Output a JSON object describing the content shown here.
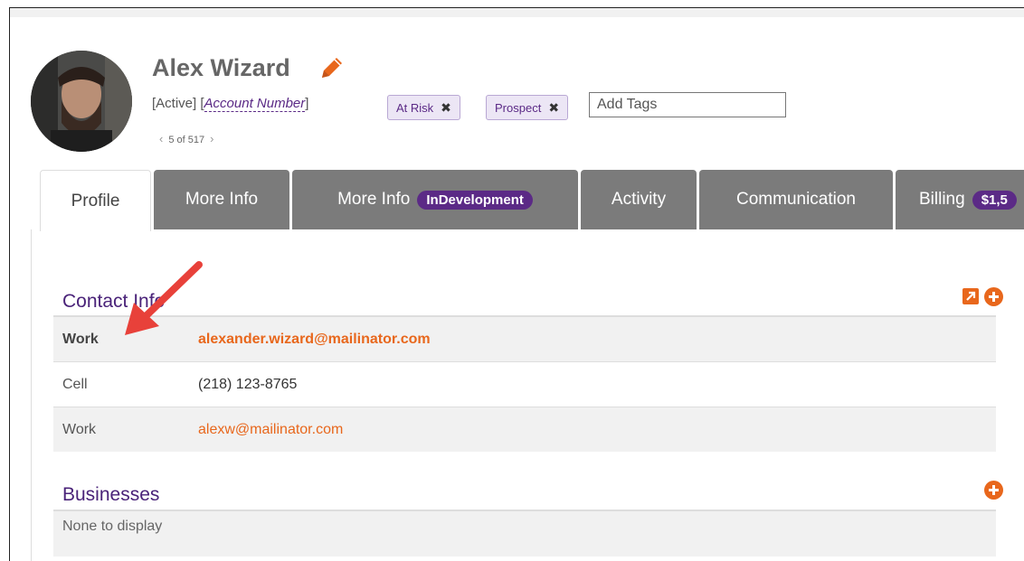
{
  "contact": {
    "name": "Alex Wizard",
    "status": "[Active]",
    "account_open": "[",
    "account_label": "Account Number",
    "account_close": "]",
    "tags": [
      "At Risk",
      "Prospect"
    ],
    "tag_remove_glyph": "✖",
    "tag_input_placeholder": "Add Tags",
    "pager_text": "5 of 517"
  },
  "tabs": [
    {
      "label": "Profile",
      "active": true
    },
    {
      "label": "More Info"
    },
    {
      "label": "More Info",
      "badge": "InDevelopment"
    },
    {
      "label": "Activity"
    },
    {
      "label": "Communication"
    },
    {
      "label": "Billing",
      "badge": "$1,5"
    }
  ],
  "contact_info": {
    "title": "Contact Info",
    "rows": [
      {
        "label": "Work",
        "value": "alexander.wizard@mailinator.com",
        "type": "email",
        "primary": true
      },
      {
        "label": "Cell",
        "value": "(218) 123-8765",
        "type": "phone"
      },
      {
        "label": "Work",
        "value": "alexw@mailinator.com",
        "type": "email"
      }
    ]
  },
  "businesses": {
    "title": "Businesses",
    "empty_text": "None to display"
  },
  "icons": {
    "edit": "pencil-icon",
    "expand": "external-link-icon",
    "add": "plus-circle-icon",
    "prev": "chevron-left-icon",
    "next": "chevron-right-icon",
    "annotation": "red-arrow-annotation"
  },
  "colors": {
    "accent_orange": "#e8671c",
    "brand_purple": "#5b2a86",
    "tab_gray": "#7b7b7b",
    "annotation_red": "#e8413a"
  }
}
